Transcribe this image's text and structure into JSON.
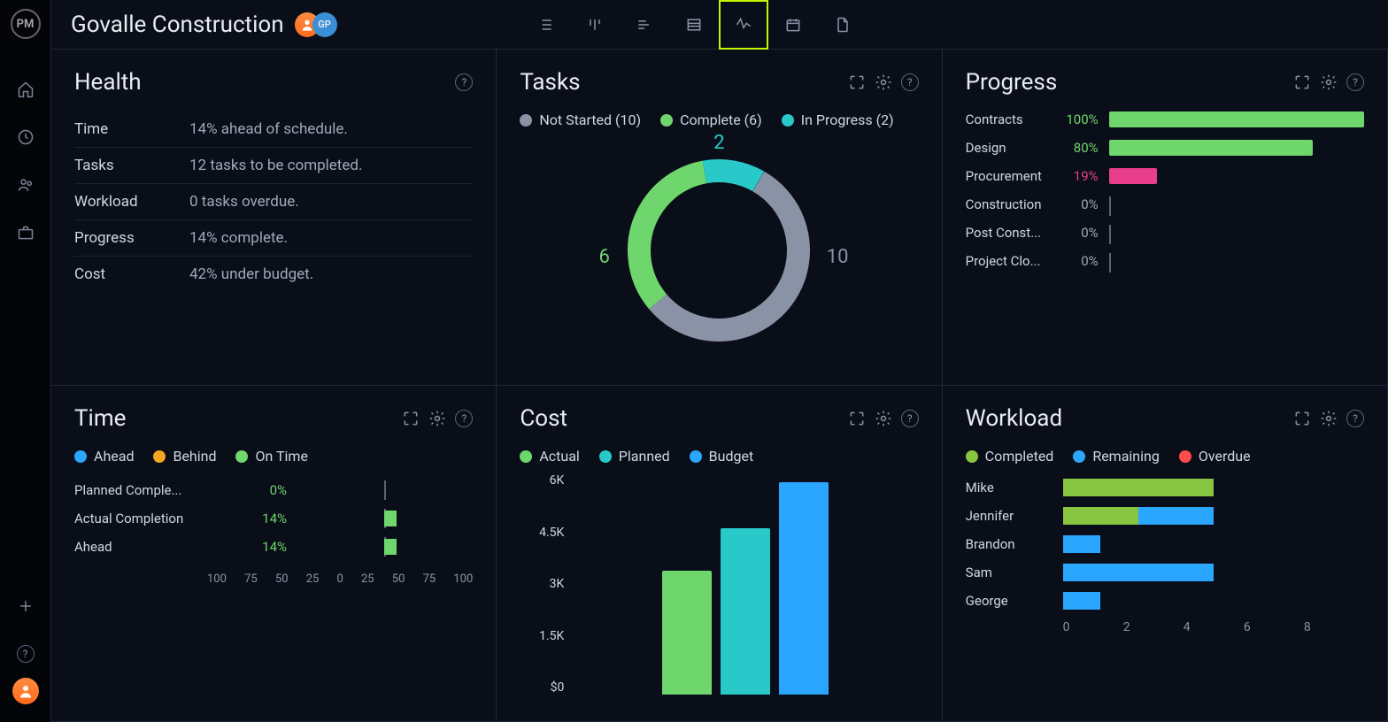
{
  "app": {
    "logo": "PM",
    "project_title": "Govalle Construction",
    "avatars": [
      "",
      ""
    ],
    "avatar2_initials": "GP"
  },
  "colors": {
    "green": "#6fd66d",
    "teal": "#29c9c9",
    "blue": "#2ba6ff",
    "orange": "#f5a623",
    "pink": "#e83e8c",
    "gray": "#8a93a5",
    "red": "#ff4d4d",
    "greenbar": "#87c540"
  },
  "health": {
    "title": "Health",
    "rows": [
      {
        "label": "Time",
        "value": "14% ahead of schedule."
      },
      {
        "label": "Tasks",
        "value": "12 tasks to be completed."
      },
      {
        "label": "Workload",
        "value": "0 tasks overdue."
      },
      {
        "label": "Progress",
        "value": "14% complete."
      },
      {
        "label": "Cost",
        "value": "42% under budget."
      }
    ]
  },
  "tasks": {
    "title": "Tasks",
    "legend": [
      {
        "label": "Not Started (10)",
        "color": "#8a93a5"
      },
      {
        "label": "Complete (6)",
        "color": "#6fd66d"
      },
      {
        "label": "In Progress (2)",
        "color": "#29c9c9"
      }
    ],
    "labels": {
      "top": "2",
      "left": "6",
      "right": "10"
    }
  },
  "progress": {
    "title": "Progress",
    "rows": [
      {
        "label": "Contracts",
        "pct": "100%",
        "val": 100,
        "color": "#6fd66d",
        "pcol": "#6fd66d"
      },
      {
        "label": "Design",
        "pct": "80%",
        "val": 80,
        "color": "#6fd66d",
        "pcol": "#6fd66d"
      },
      {
        "label": "Procurement",
        "pct": "19%",
        "val": 19,
        "color": "#e83e8c",
        "pcol": "#e83e8c"
      },
      {
        "label": "Construction",
        "pct": "0%",
        "val": 0,
        "color": "",
        "pcol": "#9fa8bc"
      },
      {
        "label": "Post Const...",
        "pct": "0%",
        "val": 0,
        "color": "",
        "pcol": "#9fa8bc"
      },
      {
        "label": "Project Clo...",
        "pct": "0%",
        "val": 0,
        "color": "",
        "pcol": "#9fa8bc"
      }
    ]
  },
  "time": {
    "title": "Time",
    "legend": [
      {
        "label": "Ahead",
        "color": "#2ba6ff"
      },
      {
        "label": "Behind",
        "color": "#f5a623"
      },
      {
        "label": "On Time",
        "color": "#6fd66d"
      }
    ],
    "rows": [
      {
        "label": "Planned Comple...",
        "pct": "0%",
        "dir": "right",
        "val": 0
      },
      {
        "label": "Actual Completion",
        "pct": "14%",
        "dir": "right",
        "val": 14
      },
      {
        "label": "Ahead",
        "pct": "14%",
        "dir": "right",
        "val": 14
      }
    ],
    "axis": [
      "100",
      "75",
      "50",
      "25",
      "0",
      "25",
      "50",
      "75",
      "100"
    ]
  },
  "cost": {
    "title": "Cost",
    "legend": [
      {
        "label": "Actual",
        "color": "#6fd66d"
      },
      {
        "label": "Planned",
        "color": "#29c9c9"
      },
      {
        "label": "Budget",
        "color": "#2ba6ff"
      }
    ],
    "yaxis": [
      "6K",
      "4.5K",
      "3K",
      "1.5K",
      "$0"
    ]
  },
  "workload": {
    "title": "Workload",
    "legend": [
      {
        "label": "Completed",
        "color": "#87c540"
      },
      {
        "label": "Remaining",
        "color": "#2ba6ff"
      },
      {
        "label": "Overdue",
        "color": "#ff4d4d"
      }
    ],
    "axis": [
      "0",
      "2",
      "4",
      "6",
      "8"
    ],
    "rows": [
      {
        "label": "Mike",
        "segs": [
          {
            "c": "#87c540",
            "v": 4
          }
        ]
      },
      {
        "label": "Jennifer",
        "segs": [
          {
            "c": "#87c540",
            "v": 2
          },
          {
            "c": "#2ba6ff",
            "v": 2
          }
        ]
      },
      {
        "label": "Brandon",
        "segs": [
          {
            "c": "#2ba6ff",
            "v": 1
          }
        ]
      },
      {
        "label": "Sam",
        "segs": [
          {
            "c": "#2ba6ff",
            "v": 4
          }
        ]
      },
      {
        "label": "George",
        "segs": [
          {
            "c": "#2ba6ff",
            "v": 1
          }
        ]
      }
    ]
  },
  "chart_data": [
    {
      "type": "pie",
      "title": "Tasks",
      "series": [
        {
          "name": "Not Started",
          "value": 10
        },
        {
          "name": "Complete",
          "value": 6
        },
        {
          "name": "In Progress",
          "value": 2
        }
      ]
    },
    {
      "type": "bar",
      "title": "Progress",
      "categories": [
        "Contracts",
        "Design",
        "Procurement",
        "Construction",
        "Post Construction",
        "Project Closure"
      ],
      "values": [
        100,
        80,
        19,
        0,
        0,
        0
      ],
      "ylabel": "%",
      "ylim": [
        0,
        100
      ]
    },
    {
      "type": "bar",
      "title": "Time",
      "categories": [
        "Planned Completion",
        "Actual Completion",
        "Ahead"
      ],
      "values": [
        0,
        14,
        14
      ],
      "xlabel": "",
      "ylim": [
        -100,
        100
      ]
    },
    {
      "type": "bar",
      "title": "Cost",
      "categories": [
        "Actual",
        "Planned",
        "Budget"
      ],
      "values": [
        3500,
        4700,
        6000
      ],
      "ylabel": "$",
      "ylim": [
        0,
        6000
      ]
    },
    {
      "type": "bar",
      "title": "Workload",
      "categories": [
        "Mike",
        "Jennifer",
        "Brandon",
        "Sam",
        "George"
      ],
      "series": [
        {
          "name": "Completed",
          "values": [
            4,
            2,
            0,
            0,
            0
          ]
        },
        {
          "name": "Remaining",
          "values": [
            0,
            2,
            1,
            4,
            1
          ]
        },
        {
          "name": "Overdue",
          "values": [
            0,
            0,
            0,
            0,
            0
          ]
        }
      ],
      "xlim": [
        0,
        8
      ]
    }
  ]
}
